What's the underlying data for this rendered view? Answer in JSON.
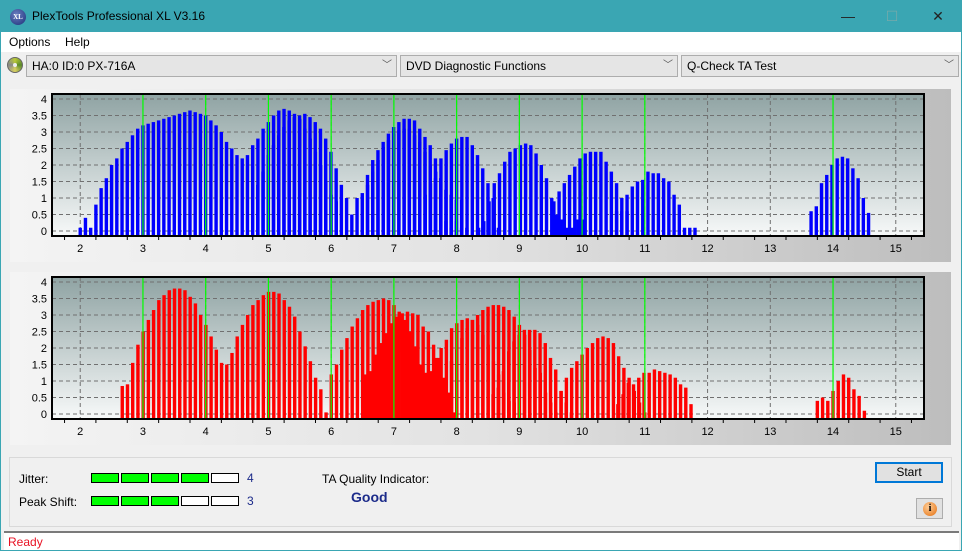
{
  "window": {
    "title": "PlexTools Professional XL V3.16",
    "icon_label": "XL",
    "minimize_icon": "minimize-icon",
    "maximize_icon": "maximize-icon",
    "close_icon": "close-icon",
    "minimize_glyph": "—",
    "maximize_glyph": "☐",
    "close_glyph": "✕"
  },
  "menu": {
    "items": [
      {
        "label": "Options"
      },
      {
        "label": "Help"
      }
    ]
  },
  "toolbar": {
    "drive": "HA:0 ID:0  PX-716A",
    "function": "DVD Diagnostic Functions",
    "test": "Q-Check TA Test",
    "chevron": "﹀"
  },
  "results": {
    "jitter_label": "Jitter:",
    "jitter_value": "4",
    "jitter_level": 4,
    "peak_shift_label": "Peak Shift:",
    "peak_shift_value": "3",
    "peak_shift_level": 3,
    "meter_max": 5,
    "ta_quality_label": "TA Quality Indicator:",
    "ta_quality_value": "Good"
  },
  "buttons": {
    "start": "Start",
    "info_glyph": "i"
  },
  "status": {
    "text": "Ready"
  },
  "colors": {
    "top_series": "#0000ff",
    "bottom_series": "#ff0000",
    "reference_lines": "#00ff00",
    "meter_on": "#00ff00",
    "quality_text": "#1c2b8a",
    "status_text": "#e81123"
  },
  "chart_data": [
    {
      "type": "bar",
      "name": "top-chart",
      "color": "#0000ff",
      "xlim": [
        1.55,
        15.45
      ],
      "ylim": [
        -0.15,
        4.15
      ],
      "x_ticks": [
        2,
        3,
        4,
        5,
        6,
        7,
        8,
        9,
        10,
        11,
        12,
        13,
        14,
        15
      ],
      "y_ticks": [
        0,
        0.5,
        1,
        1.5,
        2,
        2.5,
        3,
        3.5,
        4
      ],
      "y_tick_labels": [
        "0",
        "0.5",
        "1",
        "1.5",
        "2",
        "2.5",
        "3",
        "3.5",
        "4"
      ],
      "reference_lines": [
        3,
        4,
        5,
        6,
        7,
        8,
        9,
        10,
        11,
        14
      ],
      "grid": true,
      "clusters": [
        {
          "start": 2.0,
          "values": [
            0.1,
            0.4,
            0.1,
            0.8,
            1.3,
            1.6,
            2.0,
            2.2,
            2.5,
            2.7,
            2.9,
            3.1,
            3.2,
            3.25,
            3.3,
            3.35,
            3.4,
            3.45,
            3.5,
            3.55,
            3.6,
            3.65,
            3.6,
            3.55,
            3.5,
            3.35,
            3.2,
            3.0,
            2.7,
            2.5,
            2.3,
            2.2,
            2.3,
            2.6,
            2.8,
            3.1,
            3.3,
            3.5,
            3.65,
            3.7,
            3.65,
            3.55,
            3.4,
            3.1,
            2.8,
            2.4,
            2.0,
            1.5,
            1.1,
            0.9
          ]
        },
        {
          "start": 4.83,
          "values": [
            1.4,
            1.8,
            2.3,
            2.6,
            2.9,
            3.15,
            3.35,
            3.45,
            3.5,
            3.55,
            3.45,
            3.3,
            3.1,
            2.8,
            2.4,
            1.9,
            1.4,
            1.0,
            0.5,
            1.0,
            1.15,
            1.7,
            2.15,
            2.45,
            2.7,
            2.95,
            3.15,
            3.3,
            3.4,
            3.4,
            3.35,
            3.1,
            2.85,
            2.6,
            2.2,
            1.6,
            1.25,
            1.1,
            0.95,
            0.95
          ]
        },
        {
          "start": 6.58,
          "values": [
            1.4,
            1.8,
            2.15,
            2.55,
            2.75,
            2.95,
            3.05,
            3.1,
            3.1,
            2.9,
            2.7,
            2.4,
            2.0,
            1.6,
            1.1,
            0.3,
            0.1,
            0.3,
            0.1,
            0.1
          ]
        },
        {
          "start": 7.5,
          "values": [
            1.1,
            1.45,
            1.8,
            2.2,
            2.45,
            2.65,
            2.8,
            2.85,
            2.85,
            2.6,
            2.3,
            1.9,
            1.45,
            1.0,
            0.1
          ]
        },
        {
          "start": 8.35,
          "values": [
            0.1,
            0.3,
            0.9,
            1.45,
            1.75,
            2.1,
            2.4,
            2.5,
            2.6,
            2.65,
            2.6,
            2.35,
            2.0,
            1.6,
            1.0,
            0.5,
            0.35,
            0.1,
            0.1,
            0.35,
            0.35
          ]
        },
        {
          "start": 9.55,
          "values": [
            0.9,
            1.2,
            1.45,
            1.7,
            1.95,
            2.2,
            2.35,
            2.4,
            2.4,
            2.4,
            2.1,
            1.8,
            1.45,
            1.0,
            0.6
          ]
        },
        {
          "start": 10.55,
          "values": [
            0.6,
            0.6,
            1.1,
            1.35,
            1.5,
            1.55,
            1.8,
            1.75,
            1.75,
            1.6,
            1.5,
            1.1,
            0.8,
            0.1,
            0.1,
            0.1
          ]
        },
        {
          "start": 13.65,
          "values": [
            0.6,
            0.75,
            1.45,
            1.7,
            2.0,
            2.2,
            2.25,
            2.2,
            1.9,
            1.6,
            1.0,
            0.55
          ]
        }
      ],
      "bar_step": 0.0833
    },
    {
      "type": "bar",
      "name": "bottom-chart",
      "color": "#ff0000",
      "xlim": [
        1.55,
        15.45
      ],
      "ylim": [
        -0.15,
        4.15
      ],
      "x_ticks": [
        2,
        3,
        4,
        5,
        6,
        7,
        8,
        9,
        10,
        11,
        12,
        13,
        14,
        15
      ],
      "y_ticks": [
        0,
        0.5,
        1,
        1.5,
        2,
        2.5,
        3,
        3.5,
        4
      ],
      "y_tick_labels": [
        "0",
        "0.5",
        "1",
        "1.5",
        "2",
        "2.5",
        "3",
        "3.5",
        "4"
      ],
      "reference_lines": [
        3,
        4,
        5,
        6,
        7,
        8,
        9,
        10,
        11,
        14
      ],
      "grid": true,
      "clusters": [
        {
          "start": 2.67,
          "values": [
            0.85,
            0.9,
            1.55,
            2.1,
            2.5,
            2.85,
            3.15,
            3.45,
            3.6,
            3.75,
            3.8,
            3.8,
            3.75,
            3.55,
            3.35,
            3.0,
            2.7,
            2.35,
            1.95,
            1.55,
            1.5,
            1.85,
            2.35,
            2.7,
            3.0,
            3.3,
            3.45,
            3.6,
            3.7,
            3.7,
            3.65,
            3.45,
            3.25,
            2.95,
            2.5,
            2.05,
            1.6,
            1.1,
            0.75,
            0.05,
            1.2,
            1.5,
            1.95,
            2.3,
            2.65,
            2.9,
            3.15,
            3.3,
            3.4,
            3.45,
            3.5,
            3.45,
            3.3,
            3.1,
            2.85,
            2.5,
            2.05,
            1.5,
            1.25,
            0.95,
            0.8,
            0.65,
            1.05,
            1.6,
            1.95,
            2.3,
            2.6,
            2.85,
            3.0,
            3.15,
            3.25,
            3.3,
            3.3,
            3.25,
            3.15,
            2.95,
            2.7,
            2.4,
            1.95,
            1.4,
            1.25,
            0.65,
            0.35
          ]
        },
        {
          "start": 6.55,
          "values": [
            1.2,
            1.3,
            1.8,
            2.15,
            2.45,
            2.75,
            2.95,
            3.05,
            3.1,
            3.05,
            3.0,
            2.65,
            2.5,
            2.1,
            1.7,
            1.1,
            0.65,
            0.05
          ]
        },
        {
          "start": 7.42,
          "values": [
            0.4,
            0.7,
            1.3,
            1.7,
            2.0,
            2.25,
            2.6,
            2.75,
            2.85,
            2.9,
            2.85,
            2.7,
            2.4,
            2.1,
            1.6,
            1.2,
            0.65,
            0.4,
            0.35
          ]
        },
        {
          "start": 8.58,
          "values": [
            0.6,
            0.8,
            1.3,
            1.9,
            2.2,
            2.4,
            2.55,
            2.55,
            2.55,
            2.45,
            2.15,
            1.7,
            1.35,
            0.7,
            0.35,
            0.05
          ]
        },
        {
          "start": 9.5,
          "values": [
            0.05,
            0.05,
            0.7,
            1.1,
            1.4,
            1.6,
            1.8,
            2.0,
            2.15,
            2.3,
            2.35,
            2.3,
            2.15,
            1.75,
            1.4,
            1.1,
            0.7,
            0.35,
            0.05
          ]
        },
        {
          "start": 10.57,
          "values": [
            0.3,
            0.6,
            0.95,
            0.9,
            1.1,
            1.25,
            1.25,
            1.35,
            1.3,
            1.25,
            1.2,
            1.1,
            0.9,
            0.8,
            0.3
          ]
        },
        {
          "start": 13.75,
          "values": [
            0.4,
            0.5,
            0.4,
            0.7,
            1.0,
            1.2,
            1.1,
            0.75,
            0.55,
            0.1
          ]
        }
      ],
      "bar_step": 0.0833
    }
  ]
}
